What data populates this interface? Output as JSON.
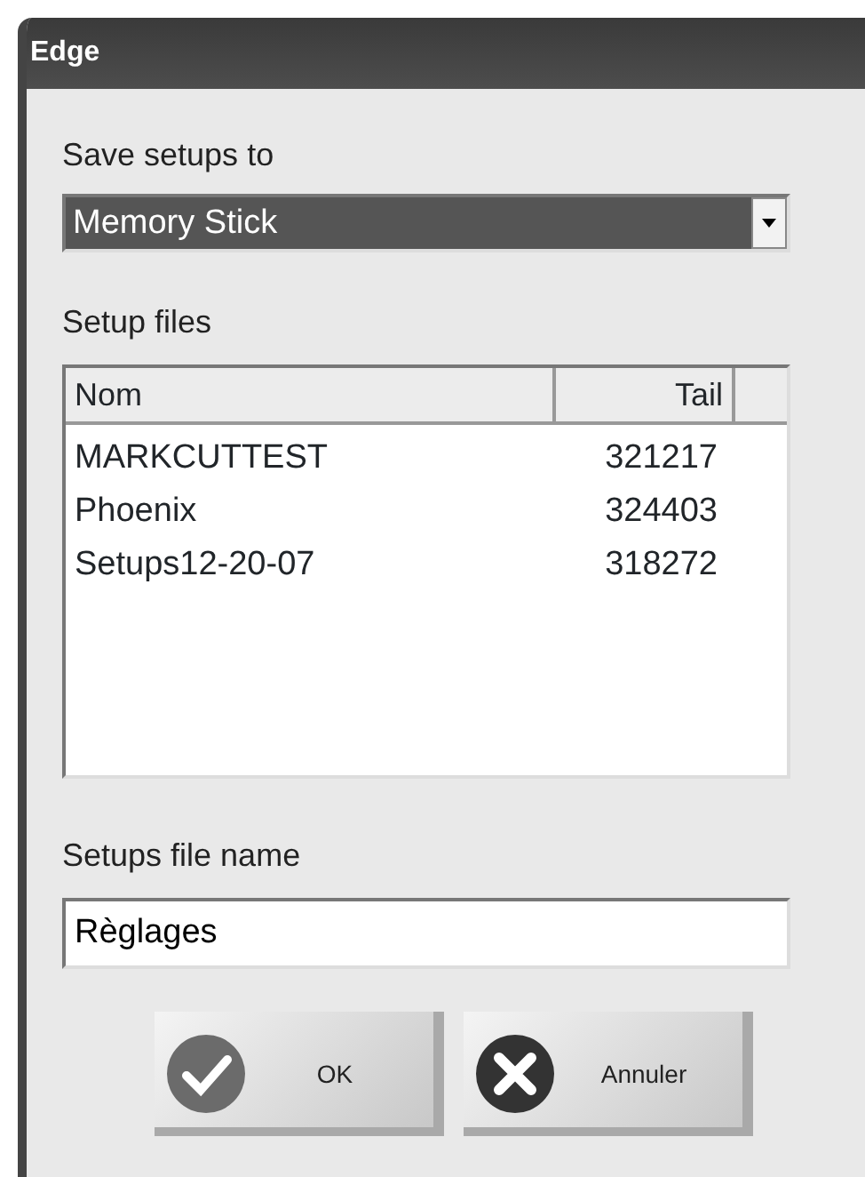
{
  "window": {
    "title": "Edge"
  },
  "save_to": {
    "label": "Save setups to",
    "value": "Memory Stick",
    "highlighted": true
  },
  "files": {
    "label": "Setup files",
    "columns": [
      "Nom",
      "Tail"
    ],
    "rows": [
      {
        "name": "MARKCUTTEST",
        "size": "321217"
      },
      {
        "name": "Phoenix",
        "size": "324403"
      },
      {
        "name": "Setups12-20-07",
        "size": "318272"
      }
    ]
  },
  "file_name": {
    "label": "Setups file name",
    "value": "Règlages"
  },
  "buttons": [
    {
      "label": "OK",
      "kind": "ok"
    },
    {
      "label": "Annuler",
      "kind": "cancel"
    }
  ]
}
